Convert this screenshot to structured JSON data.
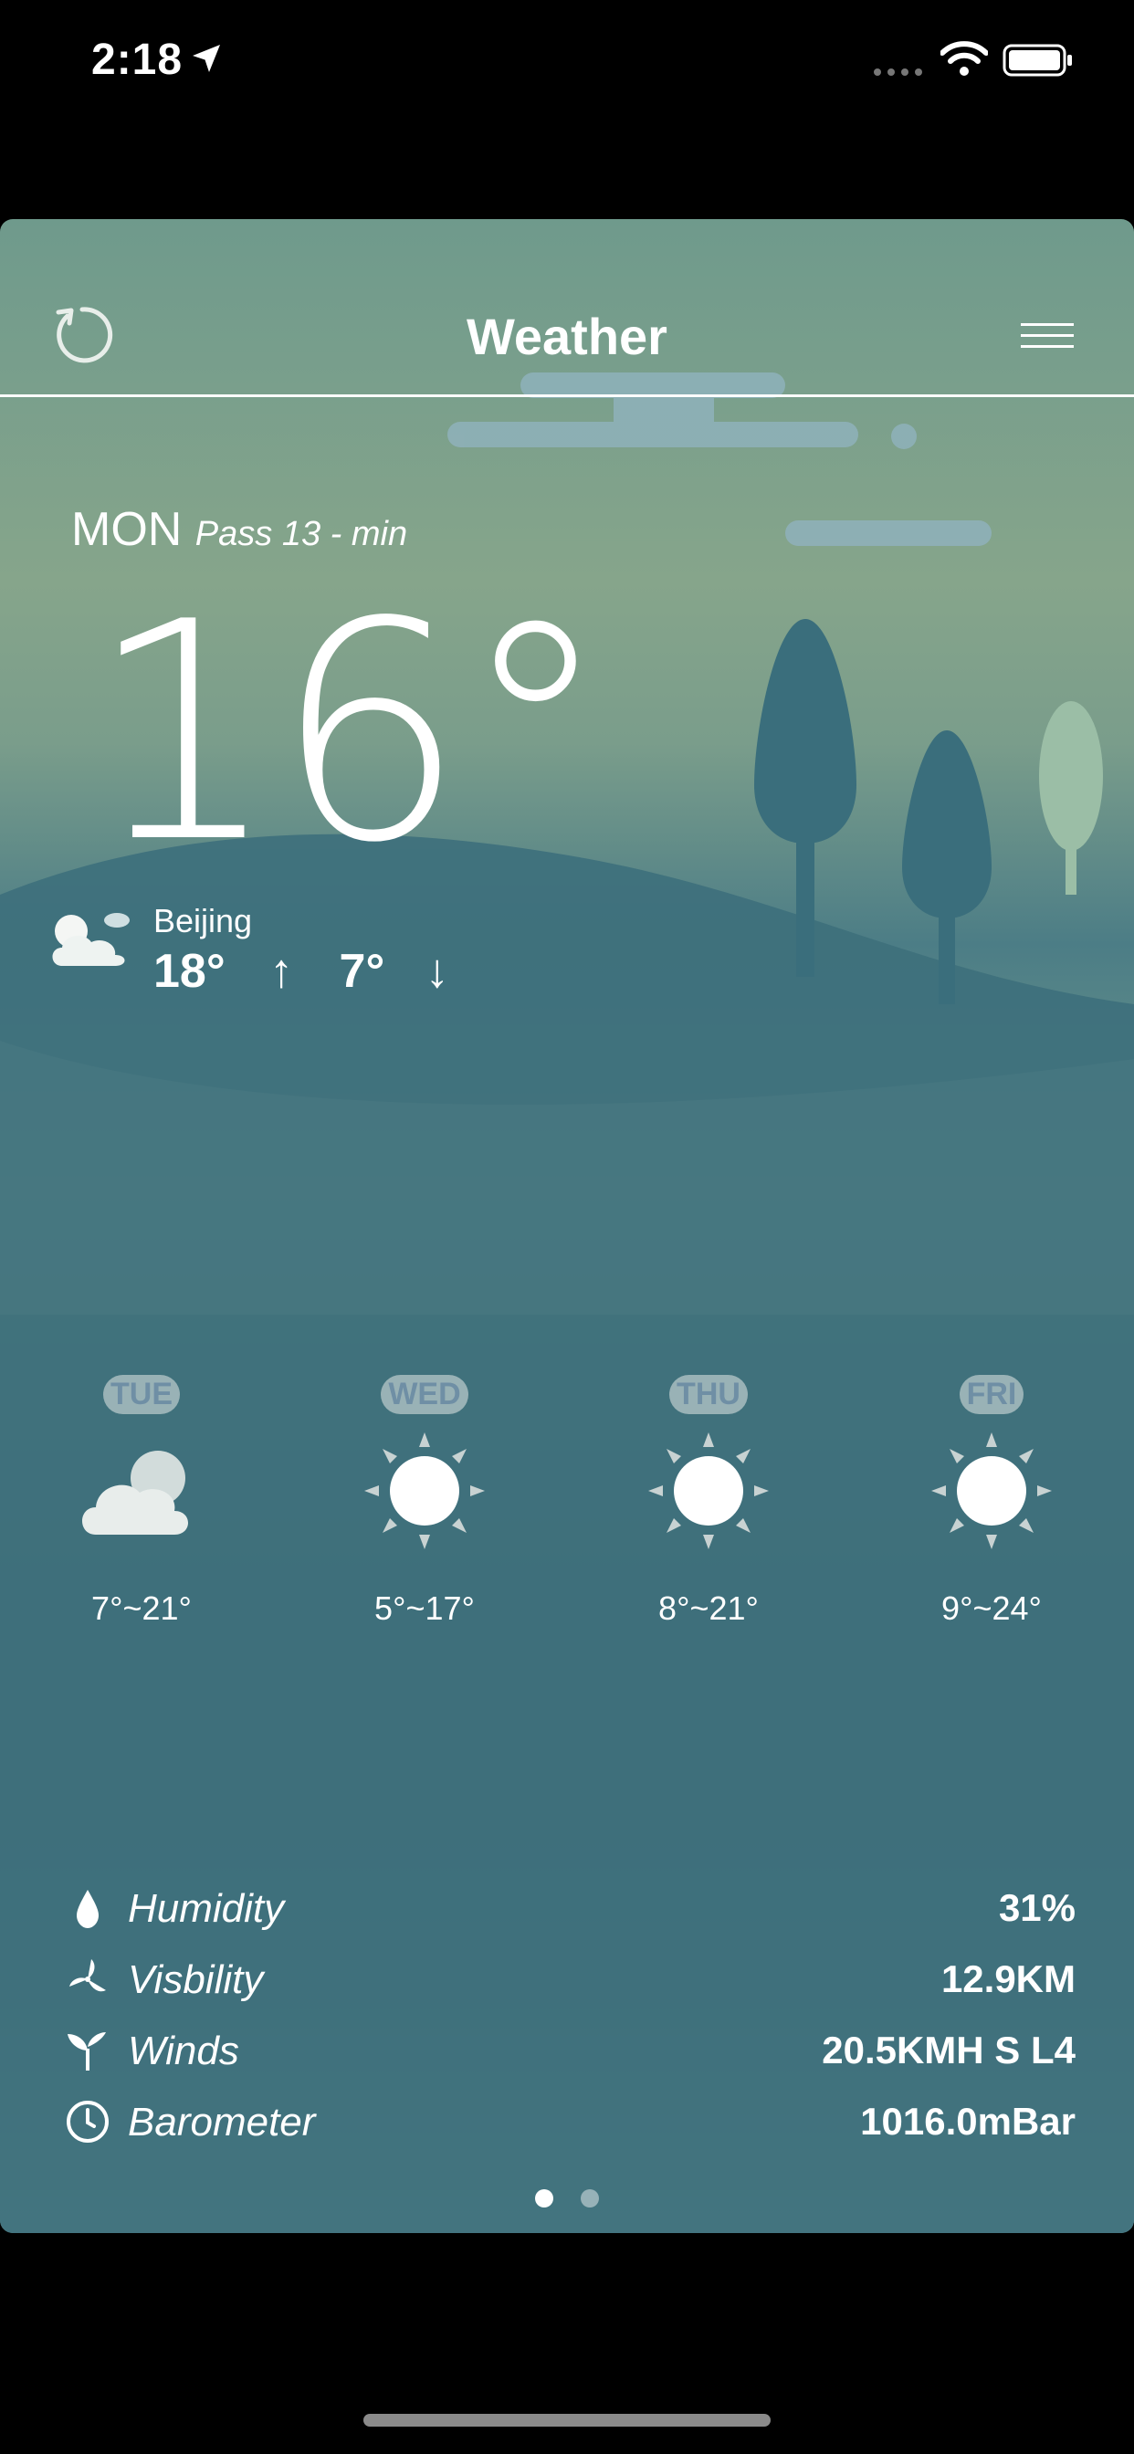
{
  "status_bar": {
    "time": "2:18"
  },
  "header": {
    "title": "Weather",
    "refresh_icon": "refresh-icon",
    "menu_icon": "menu-icon"
  },
  "current": {
    "day": "MON",
    "updated": "Pass 13 - min",
    "temperature": "16°",
    "city": "Beijing",
    "high": "18°",
    "high_arrow": "↑",
    "low": "7°",
    "low_arrow": "↓",
    "condition_icon": "partly-cloudy-icon"
  },
  "forecast": [
    {
      "day": "TUE",
      "range": "7°~21°",
      "icon": "partly-cloudy-icon"
    },
    {
      "day": "WED",
      "range": "5°~17°",
      "icon": "sun-icon"
    },
    {
      "day": "THU",
      "range": "8°~21°",
      "icon": "sun-icon"
    },
    {
      "day": "FRI",
      "range": "9°~24°",
      "icon": "sun-icon"
    }
  ],
  "details": [
    {
      "label": "Humidity",
      "value": "31%",
      "icon": "droplet-icon"
    },
    {
      "label": "Visbility",
      "value": "12.9KM",
      "icon": "pinwheel-icon"
    },
    {
      "label": "Winds",
      "value": "20.5KMH S L4",
      "icon": "sprout-icon"
    },
    {
      "label": "Barometer",
      "value": "1016.0mBar",
      "icon": "clock-icon"
    }
  ],
  "pagination": {
    "pages": 2,
    "current": 1
  },
  "colors": {
    "hill": "#3e707c",
    "tree": "#3a6e7c",
    "tree_light": "#9bbea6",
    "cloud": "#8fb2bb",
    "forecast_day_text": "#6f8fa5"
  }
}
